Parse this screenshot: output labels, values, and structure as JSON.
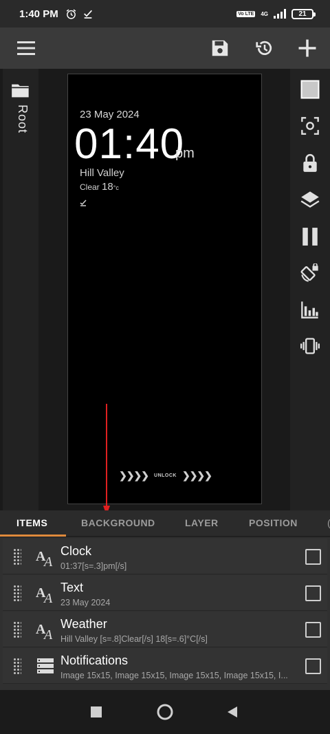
{
  "status_bar": {
    "time": "1:40 PM",
    "volte": "Vo LTE",
    "network": "4G",
    "battery": "21"
  },
  "toolbar": {
    "menu_icon": "menu-icon",
    "save_icon": "save-icon",
    "history_icon": "history-icon",
    "add_icon": "plus-icon"
  },
  "left_rail": {
    "label": "Root",
    "icon": "folder-icon"
  },
  "preview": {
    "date": "23 May 2024",
    "time": "01:40",
    "ampm": "pm",
    "city": "Hill Valley",
    "condition": "Clear",
    "temp": "18",
    "temp_unit": "°c",
    "unlock": "UNLOCK",
    "chevrons": "❯❯❯❯"
  },
  "right_rail": {
    "icons": [
      "square-icon",
      "focus-icon",
      "lock-icon",
      "layers-icon",
      "pause-icon",
      "rotate-lock-icon",
      "chart-icon",
      "vibrate-icon"
    ]
  },
  "tabs": {
    "items": [
      "ITEMS",
      "BACKGROUND",
      "LAYER",
      "POSITION"
    ],
    "active": "ITEMS"
  },
  "items": [
    {
      "title": "Clock",
      "subtitle": "01:37[s=.3]pm[/s]",
      "type": "text-icon"
    },
    {
      "title": "Text",
      "subtitle": "23 May 2024",
      "type": "text-icon"
    },
    {
      "title": "Weather",
      "subtitle": "Hill Valley [s=.8]Clear[/s] 18[s=.6]°C[/s]",
      "type": "text-icon"
    },
    {
      "title": "Notifications",
      "subtitle": "Image 15x15, Image 15x15, Image 15x15, Image 15x15, I...",
      "type": "list-icon"
    }
  ],
  "navbar": {
    "icons": [
      "recents-icon",
      "home-icon",
      "back-icon"
    ]
  },
  "colors": {
    "accent": "#e08a3c",
    "annotation_arrow": "#e02020"
  }
}
